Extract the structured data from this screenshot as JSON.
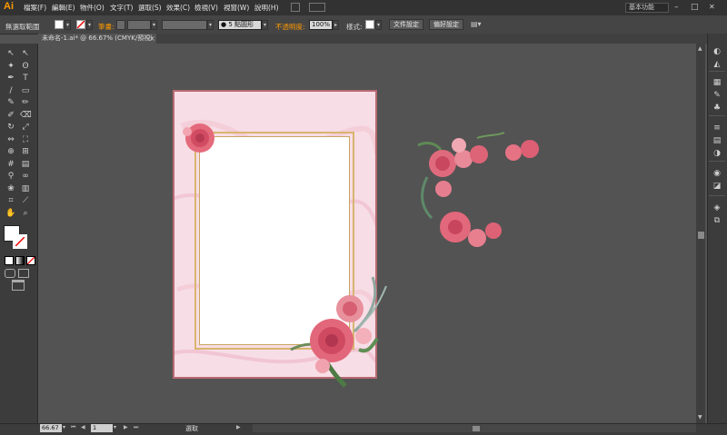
{
  "app": {
    "logo": "Ai"
  },
  "menu": [
    "檔案(F)",
    "編輯(E)",
    "物件(O)",
    "文字(T)",
    "選取(S)",
    "效果(C)",
    "檢視(V)",
    "視窗(W)",
    "說明(H)"
  ],
  "workspace": {
    "label": "基本功能"
  },
  "window_controls": {
    "minimize": "–",
    "maximize": "□",
    "close": "✕"
  },
  "control_bar": {
    "selection_label": "無選取範圍",
    "stroke_label": "筆畫:",
    "stroke_points": "5 點圓形",
    "opacity_label": "不透明度:",
    "opacity_value": "100%",
    "style_label": "樣式:",
    "doc_setup_button": "文件設定",
    "preferences_button": "偏好設定"
  },
  "document_tab": {
    "title": "未命名-1.ai* @ 66.67% (CMYK/預視)",
    "close": "×"
  },
  "status_bar": {
    "zoom": "66.67",
    "page": "1",
    "status_text": "選取"
  },
  "colors": {
    "accent": "#ff9a00",
    "artboard_border": "#b86a72",
    "gold": "#d9b56e",
    "rose": "#e0566e"
  },
  "tools": [
    "selection-icon",
    "direct-selection-icon",
    "magic-wand-icon",
    "lasso-icon",
    "pen-icon",
    "type-icon",
    "line-icon",
    "rectangle-icon",
    "paintbrush-icon",
    "pencil-icon",
    "blob-brush-icon",
    "eraser-icon",
    "rotate-icon",
    "scale-icon",
    "width-icon",
    "free-transform-icon",
    "shape-builder-icon",
    "perspective-icon",
    "mesh-icon",
    "gradient-icon",
    "eyedropper-icon",
    "blend-icon",
    "symbol-sprayer-icon",
    "graph-icon",
    "artboard-icon",
    "slice-icon",
    "hand-icon",
    "zoom-icon"
  ],
  "right_panel_icons": [
    "color-icon",
    "color-guide-icon",
    "swatches-icon",
    "brushes-icon",
    "symbols-icon",
    "stroke-icon",
    "gradient-panel-icon",
    "transparency-icon",
    "appearance-icon",
    "graphic-styles-icon",
    "layers-icon",
    "artboards-icon"
  ]
}
